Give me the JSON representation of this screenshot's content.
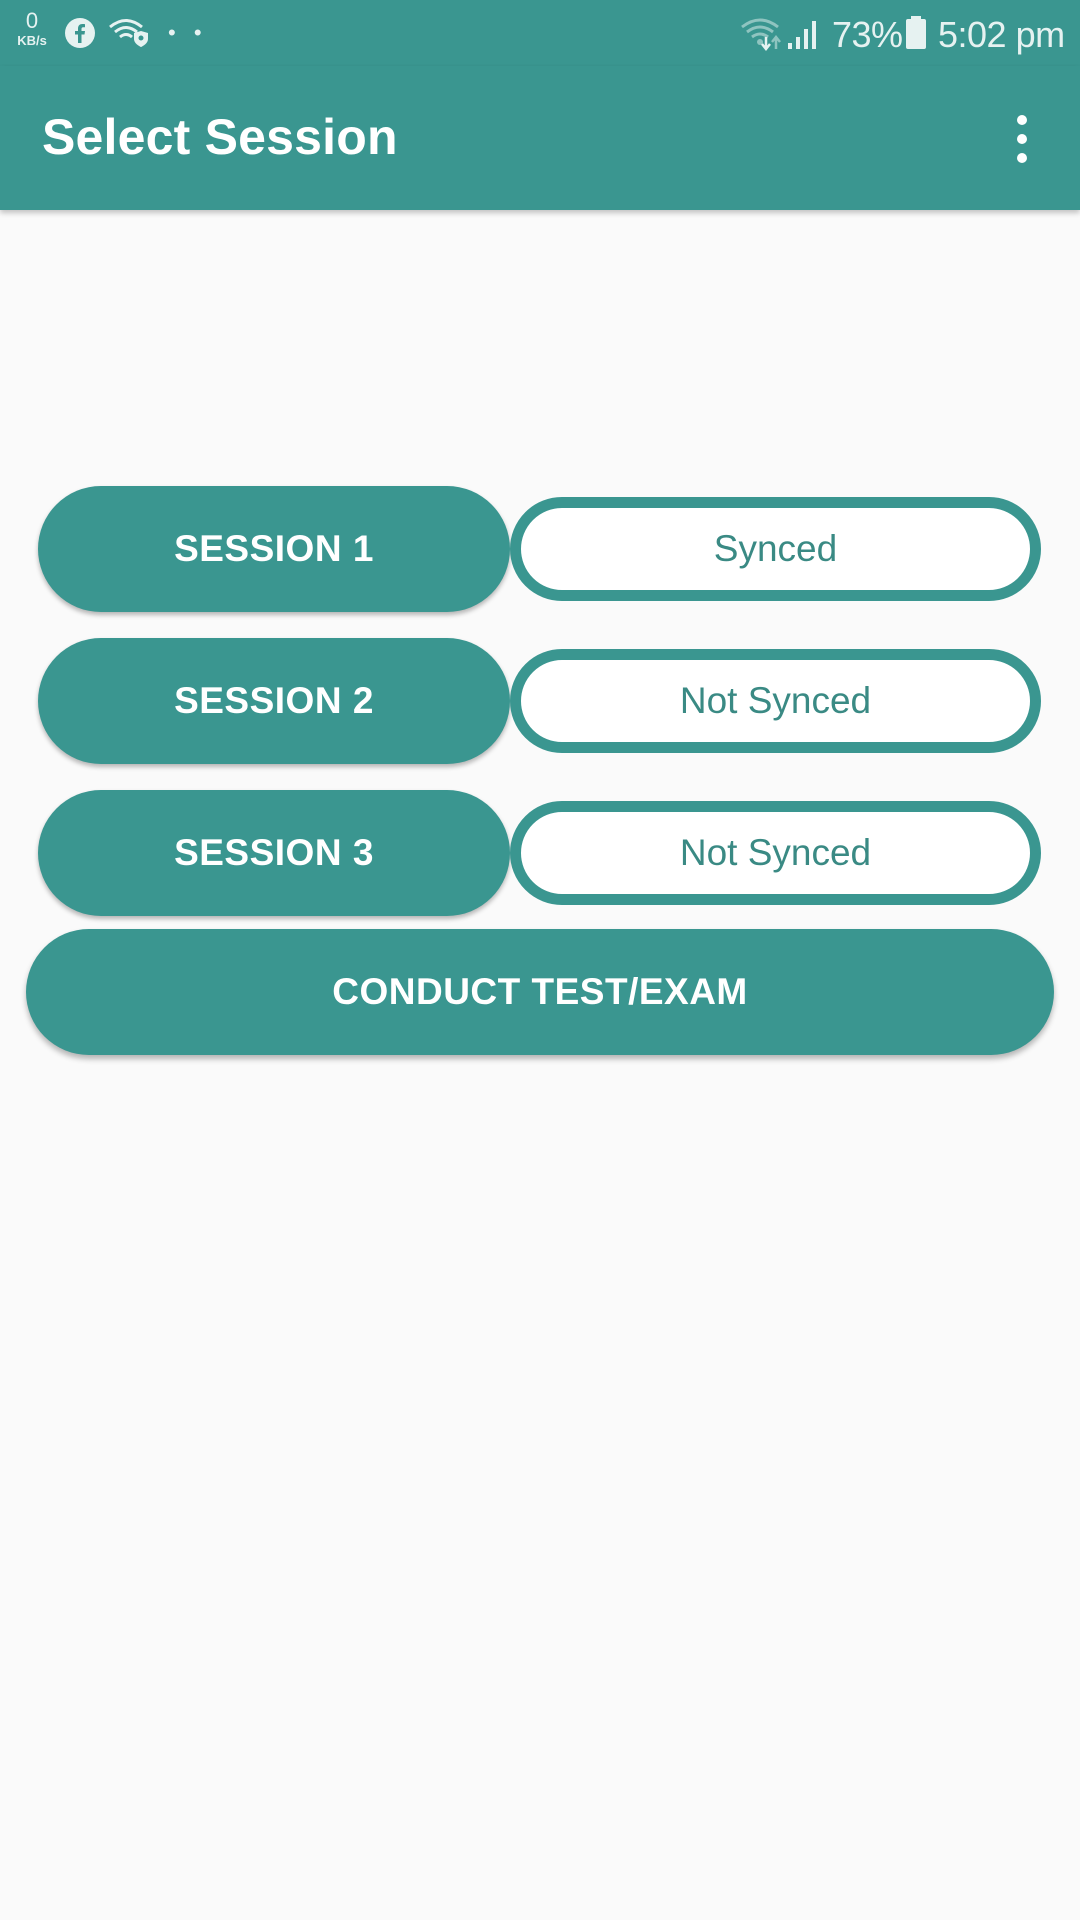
{
  "status_bar": {
    "net_speed_value": "0",
    "net_speed_unit": "KB/s",
    "dots": "• •",
    "battery_percent": "73%",
    "time": "5:02 pm",
    "icons": [
      "facebook-icon",
      "wifi-shield-icon",
      "wifi-icon",
      "signal-icon",
      "battery-icon"
    ]
  },
  "app_bar": {
    "title": "Select Session",
    "menu_icon": "more-vert-icon"
  },
  "sessions": [
    {
      "label": "SESSION 1",
      "status": "Synced"
    },
    {
      "label": "SESSION 2",
      "status": "Not Synced"
    },
    {
      "label": "SESSION 3",
      "status": "Not Synced"
    }
  ],
  "conduct_button": {
    "label": "CONDUCT TEST/EXAM"
  },
  "colors": {
    "primary": "#3a9690",
    "background": "#fafafa",
    "pill_text": "#3a8a84",
    "on_primary": "#ffffff"
  }
}
